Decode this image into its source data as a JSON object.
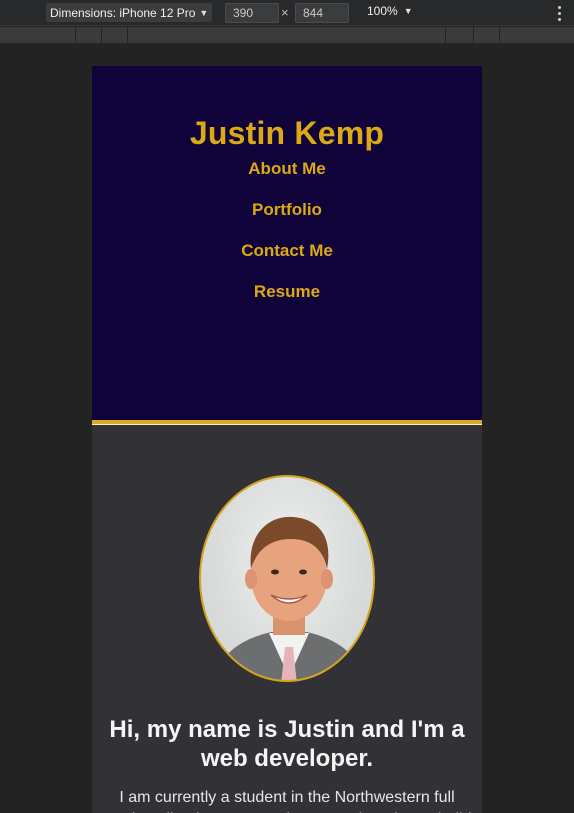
{
  "devtools": {
    "dimensions_label": "Dimensions: iPhone 12 Pro",
    "width": "390",
    "height": "844",
    "times": "×",
    "zoom": "100%"
  },
  "site": {
    "title": "Justin Kemp",
    "nav": [
      "About Me",
      "Portfolio",
      "Contact Me",
      "Resume"
    ],
    "headline": "Hi, my name is Justin and I'm a web developer.",
    "bio": "I am currently a student in the Northwestern full stack coding bootcamp, where I am learning to build modern web applications."
  },
  "colors": {
    "header_bg": "#0f033a",
    "accent_gold": "#dca915",
    "content_bg": "#323236"
  },
  "icons": [
    "caret-down-icon",
    "kebab-menu-icon",
    "profile-photo"
  ]
}
